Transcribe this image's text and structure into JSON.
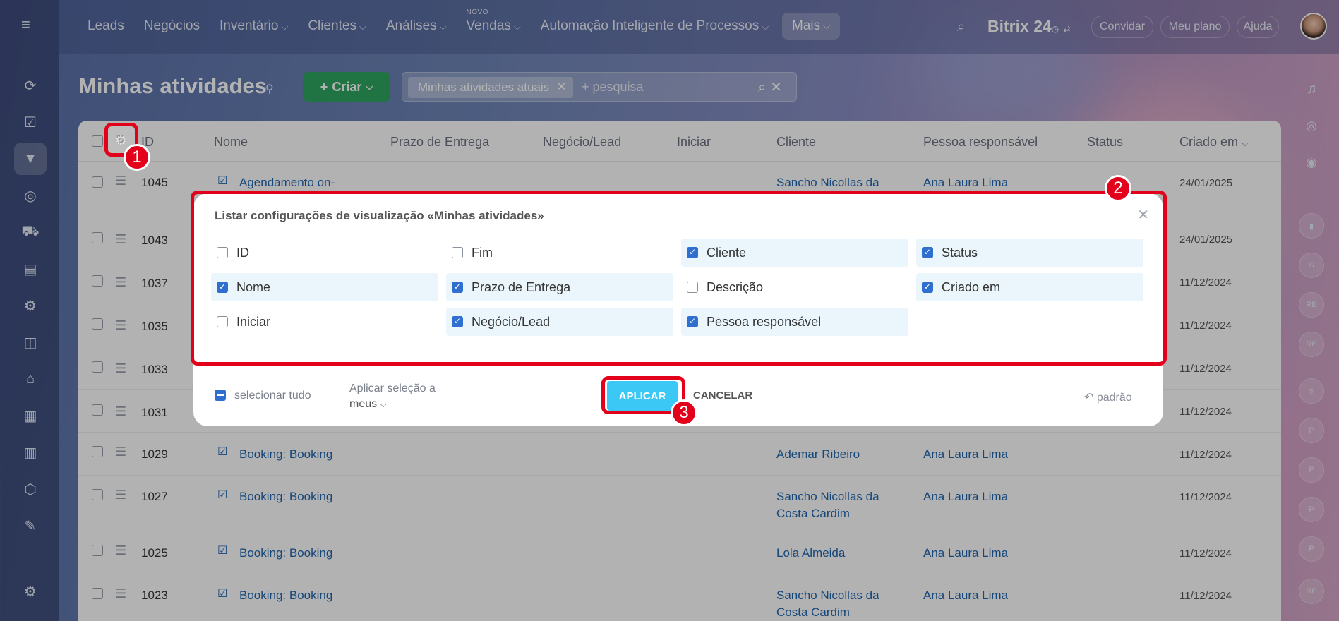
{
  "topnav": {
    "items": [
      "Leads",
      "Negócios",
      "Inventário",
      "Clientes",
      "Análises",
      "Vendas",
      "Automação Inteligente de Processos"
    ],
    "badge_novo": "NOVO",
    "mais": "Mais",
    "brand": "Bitrix",
    "brand_suffix": "24",
    "convidar": "Convidar",
    "meu_plano": "Meu plano",
    "ajuda": "Ajuda"
  },
  "page": {
    "title": "Minhas atividades",
    "criar": "Criar",
    "filter_chip": "Minhas atividades atuais",
    "search_placeholder": "+ pesquisa"
  },
  "table": {
    "headers": [
      "ID",
      "Nome",
      "Prazo de Entrega",
      "Negócio/Lead",
      "Iniciar",
      "Cliente",
      "Pessoa responsável",
      "Status",
      "Criado em"
    ],
    "rows": [
      {
        "id": "1045",
        "nome": "Agendamento on-",
        "cliente": "Sancho Nicollas da",
        "resp": "Ana Laura Lima",
        "criado": "24/01/2025"
      },
      {
        "id": "1043",
        "nome": "",
        "cliente": "",
        "resp": "",
        "criado": "24/01/2025"
      },
      {
        "id": "1037",
        "nome": "",
        "cliente": "",
        "resp": "",
        "criado": "11/12/2024"
      },
      {
        "id": "1035",
        "nome": "",
        "cliente": "",
        "resp": "",
        "criado": "11/12/2024"
      },
      {
        "id": "1033",
        "nome": "",
        "cliente": "",
        "resp": "",
        "criado": "11/12/2024"
      },
      {
        "id": "1031",
        "nome": "",
        "cliente": "",
        "resp": "",
        "criado": "11/12/2024"
      },
      {
        "id": "1029",
        "nome": "Booking: Booking",
        "cliente": "Ademar Ribeiro",
        "cliente2": "",
        "resp": "Ana Laura Lima",
        "criado": "11/12/2024"
      },
      {
        "id": "1027",
        "nome": "Booking: Booking",
        "cliente": "Sancho Nicollas da",
        "cliente2": "Costa Cardim",
        "resp": "Ana Laura Lima",
        "criado": "11/12/2024"
      },
      {
        "id": "1025",
        "nome": "Booking: Booking",
        "cliente": "Lola Almeida",
        "cliente2": "",
        "resp": "Ana Laura Lima",
        "criado": "11/12/2024"
      },
      {
        "id": "1023",
        "nome": "Booking: Booking",
        "cliente": "Sancho Nicollas da",
        "cliente2": "Costa Cardim",
        "resp": "Ana Laura Lima",
        "criado": "11/12/2024"
      }
    ]
  },
  "modal": {
    "title": "Listar configurações de visualização «Minhas atividades»",
    "options": [
      {
        "label": "ID",
        "checked": false
      },
      {
        "label": "Fim",
        "checked": false
      },
      {
        "label": "Cliente",
        "checked": true
      },
      {
        "label": "Status",
        "checked": true
      },
      {
        "label": "Nome",
        "checked": true
      },
      {
        "label": "Prazo de Entrega",
        "checked": true
      },
      {
        "label": "Descrição",
        "checked": false
      },
      {
        "label": "Criado em",
        "checked": true
      },
      {
        "label": "Iniciar",
        "checked": false
      },
      {
        "label": "Negócio/Lead",
        "checked": true
      },
      {
        "label": "Pessoa responsável",
        "checked": true
      }
    ],
    "select_all": "selecionar tudo",
    "apply_to_label": "Aplicar seleção a",
    "apply_to_value": "meus",
    "apply": "APLICAR",
    "cancel": "CANCELAR",
    "default": "padrão"
  },
  "callouts": [
    "1",
    "2",
    "3"
  ],
  "colors": {
    "highlight": "#e3001b",
    "apply": "#3bc8f5",
    "criar": "#2fa55f",
    "link": "#2066b0"
  }
}
